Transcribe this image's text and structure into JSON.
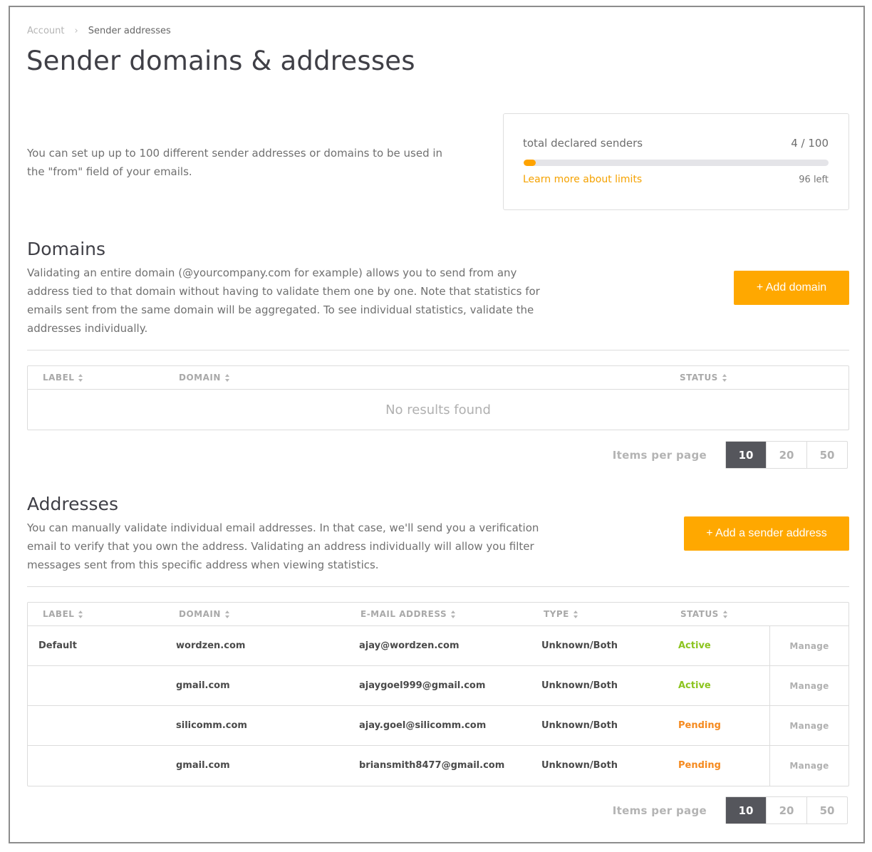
{
  "breadcrumb": {
    "parent": "Account",
    "separator": "›",
    "current": "Sender addresses"
  },
  "page": {
    "title": "Sender domains & addresses",
    "intro": "You can set up up to 100 different sender addresses or domains to be used in the \"from\" field of your emails."
  },
  "limits": {
    "label": "total declared senders",
    "count": "4 / 100",
    "progress_percent": 4,
    "link": "Learn more about limits",
    "remaining": "96 left"
  },
  "colors": {
    "accent": "#ffa800",
    "active": "#8cc41f",
    "pending": "#f58a1f",
    "selected_page": "#55565c"
  },
  "domains": {
    "title": "Domains",
    "description": "Validating an entire domain (@yourcompany.com for example) allows you to send from any address tied to that domain without having to validate them one by one. Note that statistics for emails sent from the same domain will be aggregated. To see individual statistics, validate the addresses individually.",
    "add_button": "+ Add domain",
    "columns": [
      "LABEL",
      "DOMAIN",
      "STATUS"
    ],
    "empty_message": "No results found",
    "pager": {
      "label": "Items per page",
      "options": [
        "10",
        "20",
        "50"
      ],
      "selected": "10"
    }
  },
  "addresses": {
    "title": "Addresses",
    "description": "You can manually validate individual email addresses. In that case, we'll send you a verification email to verify that you own the address. Validating an address individually will allow you filter messages sent from this specific address when viewing statistics.",
    "add_button": "+ Add a sender address",
    "columns": [
      "LABEL",
      "DOMAIN",
      "E-MAIL ADDRESS",
      "TYPE",
      "STATUS"
    ],
    "rows": [
      {
        "label": "Default",
        "domain": "wordzen.com",
        "email": "ajay@wordzen.com",
        "type": "Unknown/Both",
        "status": "Active",
        "action": "Manage"
      },
      {
        "label": "",
        "domain": "gmail.com",
        "email": "ajaygoel999@gmail.com",
        "type": "Unknown/Both",
        "status": "Active",
        "action": "Manage"
      },
      {
        "label": "",
        "domain": "silicomm.com",
        "email": "ajay.goel@silicomm.com",
        "type": "Unknown/Both",
        "status": "Pending",
        "action": "Manage"
      },
      {
        "label": "",
        "domain": "gmail.com",
        "email": "briansmith8477@gmail.com",
        "type": "Unknown/Both",
        "status": "Pending",
        "action": "Manage"
      }
    ],
    "pager": {
      "label": "Items per page",
      "options": [
        "10",
        "20",
        "50"
      ],
      "selected": "10"
    }
  }
}
